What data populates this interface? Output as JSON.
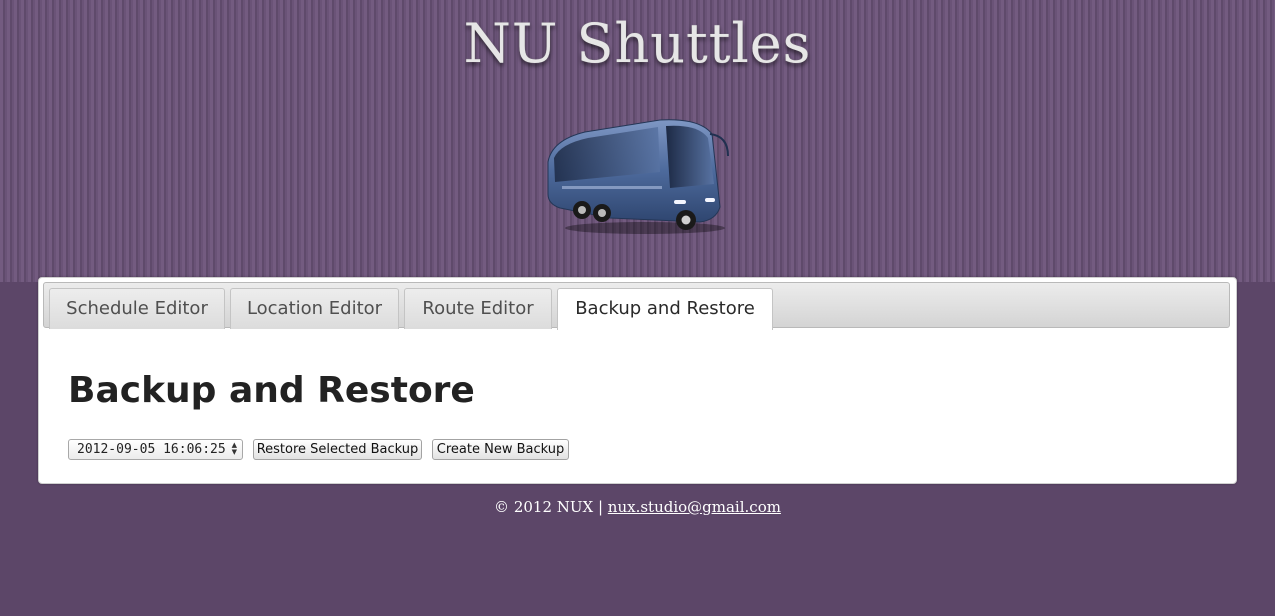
{
  "site": {
    "title": "NU Shuttles"
  },
  "tabs": [
    {
      "label": "Schedule Editor",
      "active": false
    },
    {
      "label": "Location Editor",
      "active": false
    },
    {
      "label": "Route Editor",
      "active": false
    },
    {
      "label": "Backup and Restore",
      "active": true
    }
  ],
  "main": {
    "heading": "Backup and Restore",
    "backup_select": {
      "selected": "2012-09-05 16:06:25"
    },
    "restore_button_label": "Restore Selected Backup",
    "create_button_label": "Create New Backup"
  },
  "footer": {
    "copyright": "© 2012 NUX | ",
    "email": "nux.studio@gmail.com"
  },
  "colors": {
    "background": "#5c4668",
    "header_stripes": "#6c5479",
    "panel": "#ffffff",
    "bus_body": "#4d6a9c"
  },
  "icons": {
    "logo": "bus-icon",
    "select_arrows": "updown-arrows-icon"
  }
}
